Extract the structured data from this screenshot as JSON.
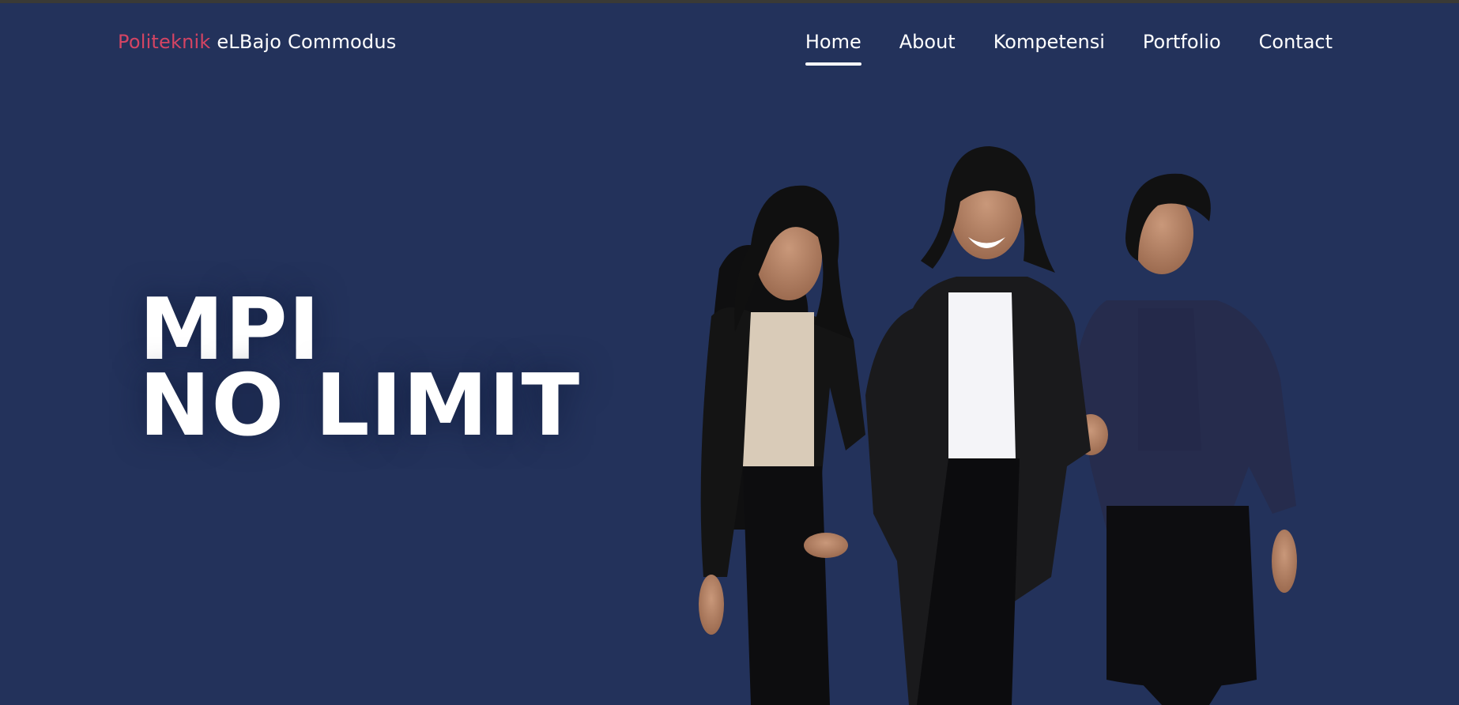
{
  "brand": {
    "accent_text": "Politeknik",
    "name_text": " eLBajo Commodus"
  },
  "nav": {
    "items": [
      {
        "label": "Home",
        "active": true
      },
      {
        "label": "About",
        "active": false
      },
      {
        "label": "Kompetensi",
        "active": false
      },
      {
        "label": "Portfolio",
        "active": false
      },
      {
        "label": "Contact",
        "active": false
      }
    ]
  },
  "hero": {
    "line1": "MPI",
    "line2": "NO LIMIT"
  },
  "colors": {
    "background": "#23325b",
    "brand_accent": "#d44463",
    "text": "#ffffff"
  }
}
